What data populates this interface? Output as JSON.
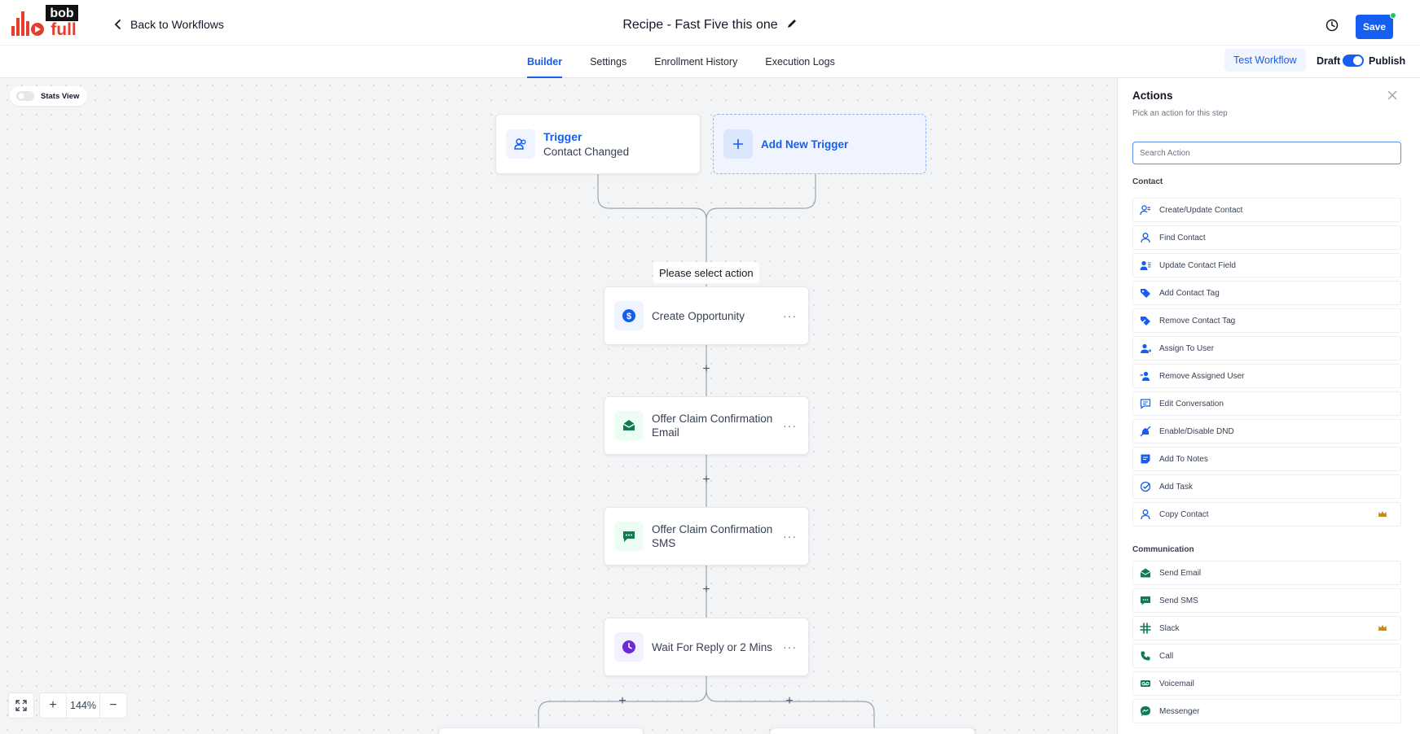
{
  "header": {
    "logo_text_top": "bob",
    "logo_text_bottom": "full",
    "back_label": "Back to Workflows",
    "title": "Recipe - Fast Five this one",
    "save_label": "Save"
  },
  "tabs": [
    {
      "label": "Builder",
      "active": true
    },
    {
      "label": "Settings",
      "active": false
    },
    {
      "label": "Enrollment History",
      "active": false
    },
    {
      "label": "Execution Logs",
      "active": false
    }
  ],
  "toolbar": {
    "test_label": "Test Workflow",
    "draft_label": "Draft",
    "publish_label": "Publish",
    "publish_on": true
  },
  "canvas": {
    "stats_label": "Stats View",
    "stats_on": false,
    "trigger": {
      "title": "Trigger",
      "subtitle": "Contact Changed"
    },
    "add_trigger_label": "Add New Trigger",
    "please_select": "Please select action",
    "steps": [
      {
        "label": "Create Opportunity",
        "icon": "dollar-icon",
        "color": "#155eef",
        "bg": "#eff4ff"
      },
      {
        "label": "Offer Claim Confirmation Email",
        "icon": "mail-open-icon",
        "color": "#0f7b55",
        "bg": "#ecfdf3"
      },
      {
        "label": "Offer Claim Confirmation SMS",
        "icon": "chat-bubble-icon",
        "color": "#0f7b55",
        "bg": "#ecfdf3"
      },
      {
        "label": "Wait For Reply or 2 Mins",
        "icon": "clock-icon",
        "color": "#6d28d9",
        "bg": "#f4f0ff"
      }
    ],
    "zoom": "144%",
    "more_label": "···"
  },
  "panel": {
    "title": "Actions",
    "subtitle": "Pick an action for this step",
    "search_placeholder": "Search Action",
    "groups": [
      {
        "name": "Contact",
        "items": [
          {
            "label": "Create/Update Contact",
            "icon": "user-edit-icon",
            "premium": false
          },
          {
            "label": "Find Contact",
            "icon": "user-icon",
            "premium": false
          },
          {
            "label": "Update Contact Field",
            "icon": "user-lines-icon",
            "premium": false
          },
          {
            "label": "Add Contact Tag",
            "icon": "tag-icon",
            "premium": false
          },
          {
            "label": "Remove Contact Tag",
            "icon": "tag-remove-icon",
            "premium": false
          },
          {
            "label": "Assign To User",
            "icon": "user-assign-icon",
            "premium": false
          },
          {
            "label": "Remove Assigned User",
            "icon": "user-remove-icon",
            "premium": false
          },
          {
            "label": "Edit Conversation",
            "icon": "conversation-icon",
            "premium": false
          },
          {
            "label": "Enable/Disable DND",
            "icon": "dnd-icon",
            "premium": false
          },
          {
            "label": "Add To Notes",
            "icon": "notes-icon",
            "premium": false
          },
          {
            "label": "Add Task",
            "icon": "task-check-icon",
            "premium": false
          },
          {
            "label": "Copy Contact",
            "icon": "user-copy-icon",
            "premium": true
          }
        ]
      },
      {
        "name": "Communication",
        "items": [
          {
            "label": "Send Email",
            "icon": "mail-open-icon",
            "premium": false
          },
          {
            "label": "Send SMS",
            "icon": "chat-bubble-icon",
            "premium": false
          },
          {
            "label": "Slack",
            "icon": "slack-icon",
            "premium": true
          },
          {
            "label": "Call",
            "icon": "phone-icon",
            "premium": false
          },
          {
            "label": "Voicemail",
            "icon": "voicemail-icon",
            "premium": false
          },
          {
            "label": "Messenger",
            "icon": "messenger-icon",
            "premium": false
          }
        ]
      }
    ]
  },
  "colors": {
    "accent": "#155eef",
    "logo": "#e53e2e",
    "premium": "#c68a1a",
    "comm": "#0f7b55"
  }
}
